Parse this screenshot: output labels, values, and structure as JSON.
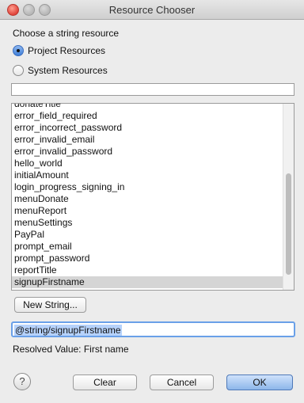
{
  "window": {
    "title": "Resource Chooser"
  },
  "labels": {
    "choose": "Choose a string resource",
    "resolved": "Resolved Value: First name"
  },
  "radios": [
    {
      "label": "Project Resources",
      "checked": true
    },
    {
      "label": "System Resources",
      "checked": false
    }
  ],
  "filter": {
    "value": ""
  },
  "list": {
    "items": [
      "donateTitle",
      "error_field_required",
      "error_incorrect_password",
      "error_invalid_email",
      "error_invalid_password",
      "hello_world",
      "initialAmount",
      "login_progress_signing_in",
      "menuDonate",
      "menuReport",
      "menuSettings",
      "PayPal",
      "prompt_email",
      "prompt_password",
      "reportTitle",
      "signupFirstname"
    ],
    "selected": "signupFirstname"
  },
  "buttons": {
    "new_string": "New String...",
    "clear": "Clear",
    "cancel": "Cancel",
    "ok": "OK"
  },
  "value_field": {
    "value": "@string/signupFirstname"
  },
  "help": {
    "glyph": "?"
  }
}
